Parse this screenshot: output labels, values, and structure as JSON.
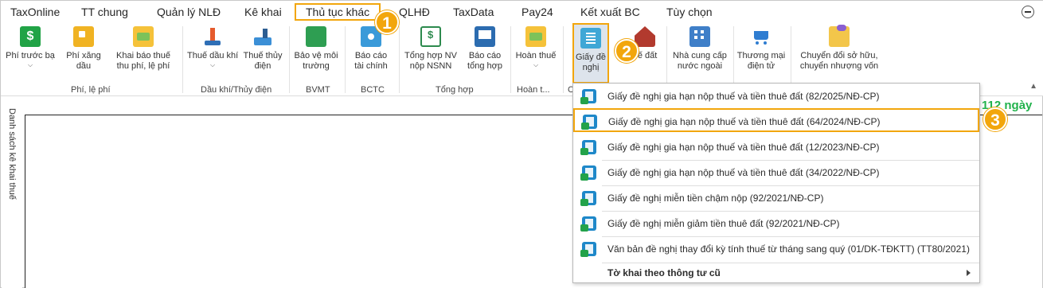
{
  "menu": {
    "tabs": [
      "TaxOnline",
      "TT chung",
      "Quản lý NLĐ",
      "Kê khai",
      "Thủ tục khác",
      "QLHĐ",
      "TaxData",
      "Pay24",
      "Kết xuất BC",
      "Tùy chọn"
    ],
    "active_tab": "Thủ tục khác"
  },
  "ribbon": {
    "buttons": [
      {
        "line1": "Phí trước bạ",
        "line2": "",
        "icon": "dollar-icon"
      },
      {
        "line1": "Phí xăng",
        "line2": "dầu",
        "icon": "fuel-pump-icon"
      },
      {
        "line1": "Khai báo thuế",
        "line2": "thu phí, lệ phí",
        "icon": "money-bag-icon"
      },
      {
        "line1": "Thuế dầu khí",
        "line2": "",
        "icon": "oil-rig-icon"
      },
      {
        "line1": "Thuế thủy",
        "line2": "điện",
        "icon": "hydropower-icon"
      },
      {
        "line1": "Bảo vệ môi",
        "line2": "trường",
        "icon": "leaf-icon"
      },
      {
        "line1": "Báo cáo",
        "line2": "tài chính",
        "icon": "disc-report-icon"
      },
      {
        "line1": "Tổng hợp NV",
        "line2": "nộp NSNN",
        "icon": "spreadsheet-icon"
      },
      {
        "line1": "Báo cáo",
        "line2": "tổng hợp",
        "icon": "presentation-icon"
      },
      {
        "line1": "Hoàn thuế",
        "line2": "",
        "icon": "refund-icon"
      },
      {
        "line1": "Giấy đề",
        "line2": "nghị",
        "icon": "document-icon"
      },
      {
        "line1": "uế đất",
        "line2": "",
        "icon": "house-icon"
      },
      {
        "line1": "Nhà cung cấp",
        "line2": "nước ngoài",
        "icon": "building-icon"
      },
      {
        "line1": "Thương mại",
        "line2": "điện tử",
        "icon": "cart-icon"
      },
      {
        "line1": "Chuyển đổi sở hữu,",
        "line2": "chuyển nhượng vốn",
        "icon": "exchange-icon"
      }
    ],
    "groups": [
      "Phí, lệ phí",
      "Dầu khí/Thủy điện",
      "BVMT",
      "BCTC",
      "Tổng hợp",
      "Hoàn t...",
      "C"
    ]
  },
  "badges": [
    "1",
    "2",
    "3"
  ],
  "left_panel": {
    "label": "Danh sách kê khai thuế"
  },
  "days_text": "112 ngày",
  "dropdown": {
    "items": [
      "Giấy đề nghị gia hạn nộp thuế và tiền thuê đất (82/2025/NĐ-CP)",
      "Giấy đề nghị gia hạn nộp thuế và tiền thuê đất (64/2024/NĐ-CP)",
      "Giấy đề nghị gia hạn nộp thuế và tiền thuê đất (12/2023/NĐ-CP)",
      "Giấy đề nghị gia hạn nộp thuế và tiền thuê đất (34/2022/NĐ-CP)",
      "Giấy đề nghị miễn tiền chậm nộp (92/2021/NĐ-CP)",
      "Giấy đề nghị miễn giảm tiền thuê đất (92/2021/NĐ-CP)",
      "Văn bản đề nghị thay đổi kỳ tính thuế từ tháng sang quý (01/DK-TĐKTT) (TT80/2021)"
    ],
    "highlighted_index": 1,
    "footer": "Tờ khai theo thông tư cũ"
  },
  "colors": {
    "highlight": "#f2a60c",
    "days_green": "#22b24c",
    "pressed_bg": "#dde4ec"
  }
}
